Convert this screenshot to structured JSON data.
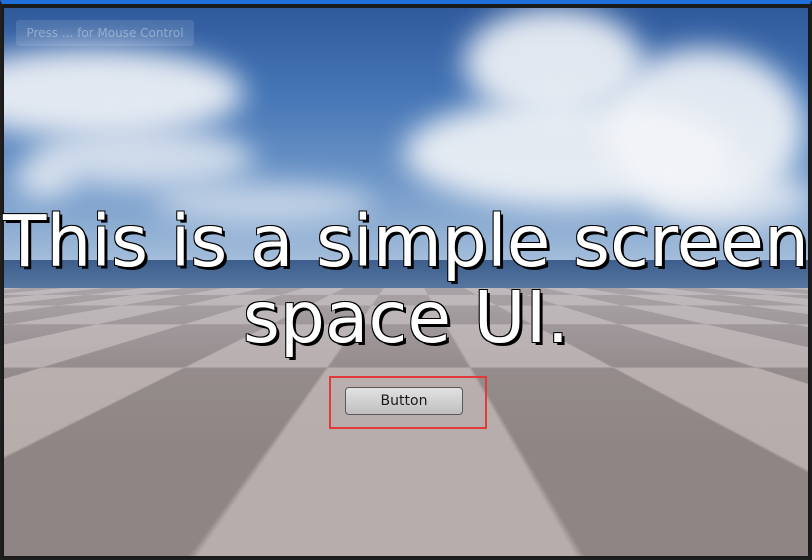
{
  "hint": {
    "label": "Press ... for Mouse Control"
  },
  "ui": {
    "headline": "This is a simple screen space UI.",
    "button_label": "Button"
  },
  "colors": {
    "frame_top": "#1e6fd9",
    "highlight": "#e23a3a",
    "text": "#ffffff"
  }
}
